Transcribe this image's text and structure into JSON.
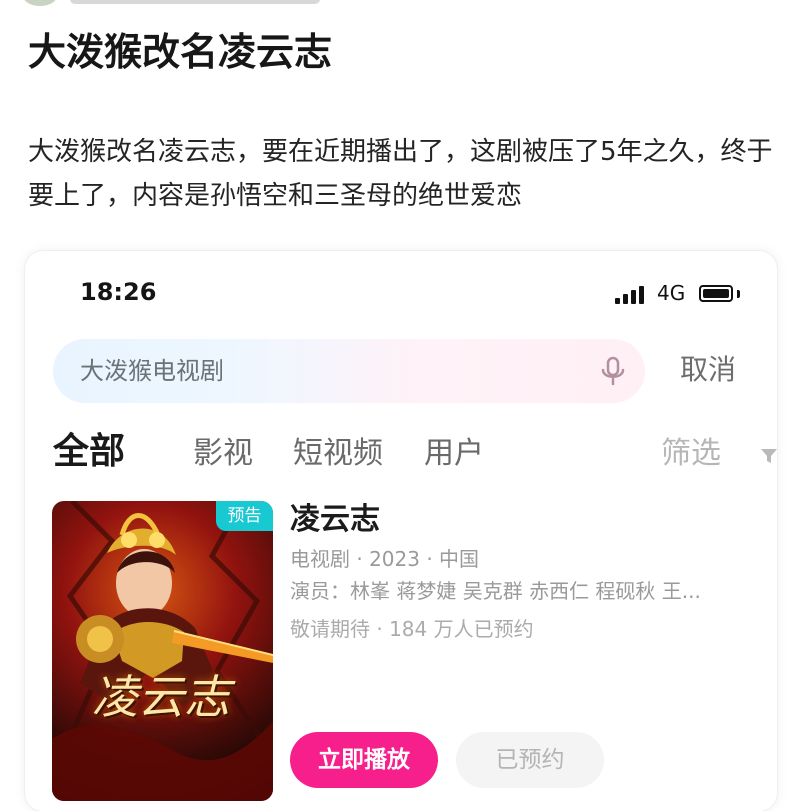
{
  "article": {
    "title": "大泼猴改名凌云志",
    "summary": "大泼猴改名凌云志，要在近期播出了，这剧被压了5年之久，终于要上了，内容是孙悟空和三圣母的绝世爱恋"
  },
  "phone": {
    "status_bar": {
      "time": "18:26",
      "network": "4G",
      "signal_icon": "signal-bars-icon",
      "battery_icon": "battery-icon"
    },
    "search": {
      "query": "大泼猴电视剧",
      "voice_icon": "microphone-icon",
      "cancel_label": "取消"
    },
    "tabs": [
      {
        "label": "全部"
      },
      {
        "label": "影视"
      },
      {
        "label": "短视频"
      },
      {
        "label": "用户"
      }
    ],
    "filter_label": "筛选",
    "filter_icon": "filter-icon",
    "result": {
      "title": "凌云志",
      "meta": "电视剧 · 2023 · 中国",
      "cast": "演员：林峯 蒋梦婕 吴克群 赤西仁 程砚秋 王...",
      "status": "敬请期待 · 184 万人已预约",
      "badge": "预告",
      "poster_title": "凌云志",
      "play_button": "立即播放",
      "reserved_button": "已预约"
    },
    "colors": {
      "accent_pink": "#f71f8b",
      "badge_cyan": "#18c9d2"
    }
  }
}
